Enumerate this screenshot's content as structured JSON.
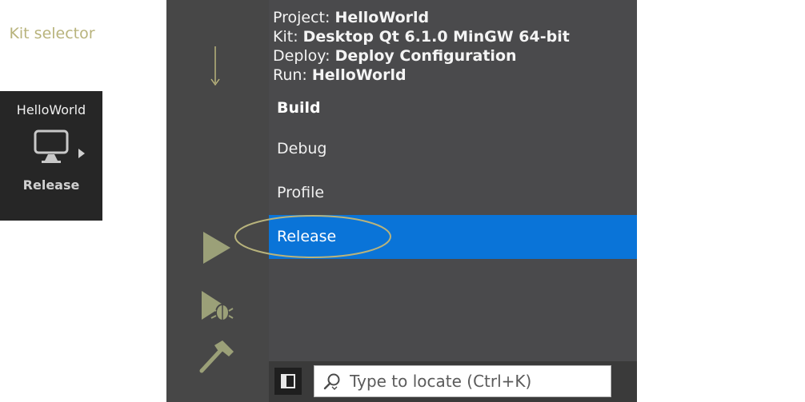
{
  "annotations": {
    "kit_selector": "Kit selector"
  },
  "sidebar": {
    "kit": {
      "project_name": "HelloWorld",
      "build_config": "Release"
    },
    "icons": {
      "monitor": "monitor-icon",
      "run": "run-icon",
      "debug": "debug-run-icon",
      "build": "hammer-icon"
    }
  },
  "panel": {
    "info": {
      "project_label": "Project:",
      "project_value": "HelloWorld",
      "kit_label": "Kit:",
      "kit_value": "Desktop Qt 6.1.0 MinGW 64-bit",
      "deploy_label": "Deploy:",
      "deploy_value": "Deploy Configuration",
      "run_label": "Run:",
      "run_value": "HelloWorld"
    },
    "section_title": "Build",
    "options": [
      {
        "label": "Debug",
        "selected": false
      },
      {
        "label": "Profile",
        "selected": false
      },
      {
        "label": "Release",
        "selected": true
      }
    ]
  },
  "bottom_bar": {
    "locator_placeholder": "Type to locate (Ctrl+K)"
  },
  "colors": {
    "sidebar": "#474747",
    "kit_selector_bg": "#262626",
    "panel": "#4a4a4c",
    "selected": "#0a74d8",
    "annotation": "#b8b37c",
    "icon": "#9ba078"
  }
}
